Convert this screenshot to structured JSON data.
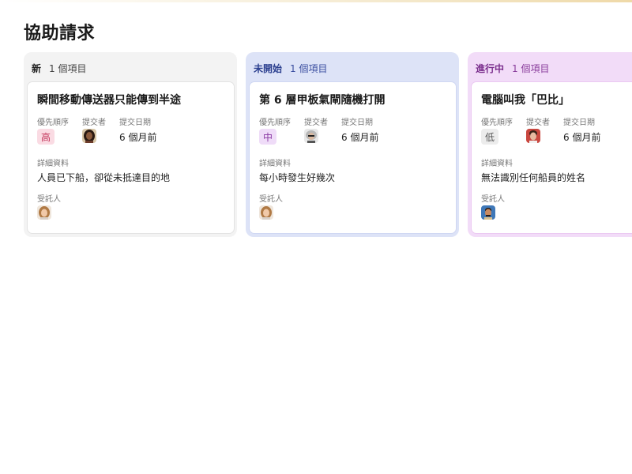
{
  "page": {
    "title": "協助請求"
  },
  "columns": [
    {
      "name": "新",
      "count": "1 個項目",
      "card": {
        "title": "瞬間移動傳送器只能傳到半途",
        "priority_label": "優先順序",
        "priority": "高",
        "submitter_label": "提交者",
        "date_label": "提交日期",
        "date": "6 個月前",
        "details_label": "詳細資料",
        "details": "人員已下船，卻從未抵達目的地",
        "assignee_label": "受託人"
      }
    },
    {
      "name": "未開始",
      "count": "1 個項目",
      "card": {
        "title": "第 6 層甲板氣閘隨機打開",
        "priority_label": "優先順序",
        "priority": "中",
        "submitter_label": "提交者",
        "date_label": "提交日期",
        "date": "6 個月前",
        "details_label": "詳細資料",
        "details": "每小時發生好幾次",
        "assignee_label": "受託人"
      }
    },
    {
      "name": "進行中",
      "count": "1 個項目",
      "card": {
        "title": "電腦叫我「巴比」",
        "priority_label": "優先順序",
        "priority": "低",
        "submitter_label": "提交者",
        "date_label": "提交日期",
        "date": "6 個月前",
        "details_label": "詳細資料",
        "details": "無法識別任何船員的姓名",
        "assignee_label": "受託人"
      }
    }
  ],
  "colors": {
    "high": "#c2345a",
    "mid": "#8b3aa3",
    "low": "#555555"
  }
}
